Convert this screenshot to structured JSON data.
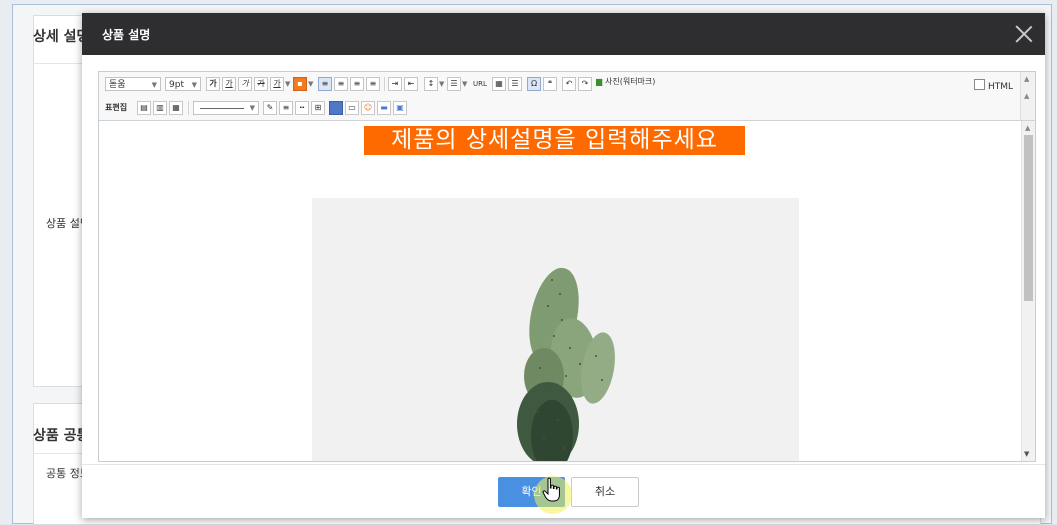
{
  "background": {
    "section_detail_title": "상세 설명",
    "section_detail_label": "상품 설명",
    "section_common_title": "상품 공통",
    "section_common_label": "공통 정보"
  },
  "modal": {
    "title": "상품 설명",
    "close_icon": "close-icon"
  },
  "toolbar": {
    "font_family": "돋움",
    "font_size": "9pt",
    "bold": "가",
    "underline": "가",
    "italic": "가",
    "strike": "가",
    "font_color": "가",
    "url_label": "URL",
    "photo_label": "사진(워터마크)",
    "html_label": "HTML",
    "table_edit_label": "표편집"
  },
  "content": {
    "headline": "제품의 상세설명을 입력해주세요"
  },
  "footer": {
    "ok_label": "확인",
    "cancel_label": "취소"
  },
  "colors": {
    "header_bg": "#2e2e30",
    "headline_bg": "#ff6a00",
    "ok_bg": "#4a90e2"
  }
}
